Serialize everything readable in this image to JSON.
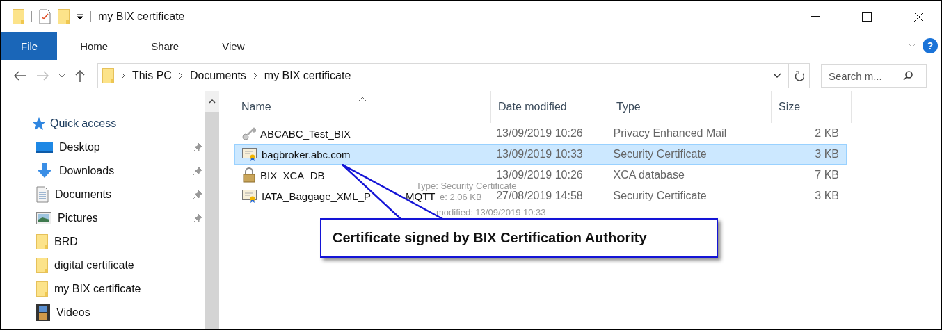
{
  "title_bar": {
    "title": "my BIX certificate"
  },
  "ribbon": {
    "tabs": [
      {
        "label": "File",
        "kind": "file"
      },
      {
        "label": "Home",
        "kind": "tab"
      },
      {
        "label": "Share",
        "kind": "tab"
      },
      {
        "label": "View",
        "kind": "tab"
      }
    ],
    "help": "?"
  },
  "address_bar": {
    "path": [
      "This PC",
      "Documents",
      "my BIX certificate"
    ]
  },
  "search": {
    "placeholder": "Search m..."
  },
  "navigation": {
    "header": "Quick access",
    "items": [
      {
        "label": "Desktop",
        "kind": "desktop",
        "pinned": true
      },
      {
        "label": "Downloads",
        "kind": "download",
        "pinned": true
      },
      {
        "label": "Documents",
        "kind": "document",
        "pinned": true
      },
      {
        "label": "Pictures",
        "kind": "picture",
        "pinned": true
      },
      {
        "label": "BRD",
        "kind": "folder",
        "pinned": false
      },
      {
        "label": "digital certificate",
        "kind": "folder",
        "pinned": false
      },
      {
        "label": "my BIX certificate",
        "kind": "folder",
        "pinned": false
      },
      {
        "label": "Videos",
        "kind": "video",
        "pinned": false
      }
    ]
  },
  "file_list": {
    "columns": [
      {
        "label": "Name",
        "sorted": true
      },
      {
        "label": "Date modified",
        "sorted": false
      },
      {
        "label": "Type",
        "sorted": false
      },
      {
        "label": "Size",
        "sorted": false
      }
    ],
    "rows": [
      {
        "name": "ABCABC_Test_BIX",
        "kind": "key",
        "date": "13/09/2019 10:26",
        "type": "Privacy Enhanced Mail",
        "size": "2 KB",
        "selected": false
      },
      {
        "name": "bagbroker.abc.com",
        "kind": "certificate",
        "date": "13/09/2019 10:33",
        "type": "Security Certificate",
        "size": "3 KB",
        "selected": true
      },
      {
        "name": "BIX_XCA_DB",
        "kind": "lock",
        "date": "13/09/2019 10:26",
        "type": "XCA database",
        "size": "7 KB",
        "selected": false
      },
      {
        "name": "IATA_Baggage_XML_P",
        "name_end": "MQTT",
        "kind": "certificate",
        "date": "27/08/2019 14:58",
        "type": "Security Certificate",
        "size": "3 KB",
        "selected": false
      }
    ]
  },
  "tooltip": {
    "lines": [
      "Type: Security Certificate",
      "e: 2.06 KB",
      "modified: 13/09/2019 10:33"
    ]
  },
  "callout": {
    "text": "Certificate signed by BIX Certification Authority"
  }
}
